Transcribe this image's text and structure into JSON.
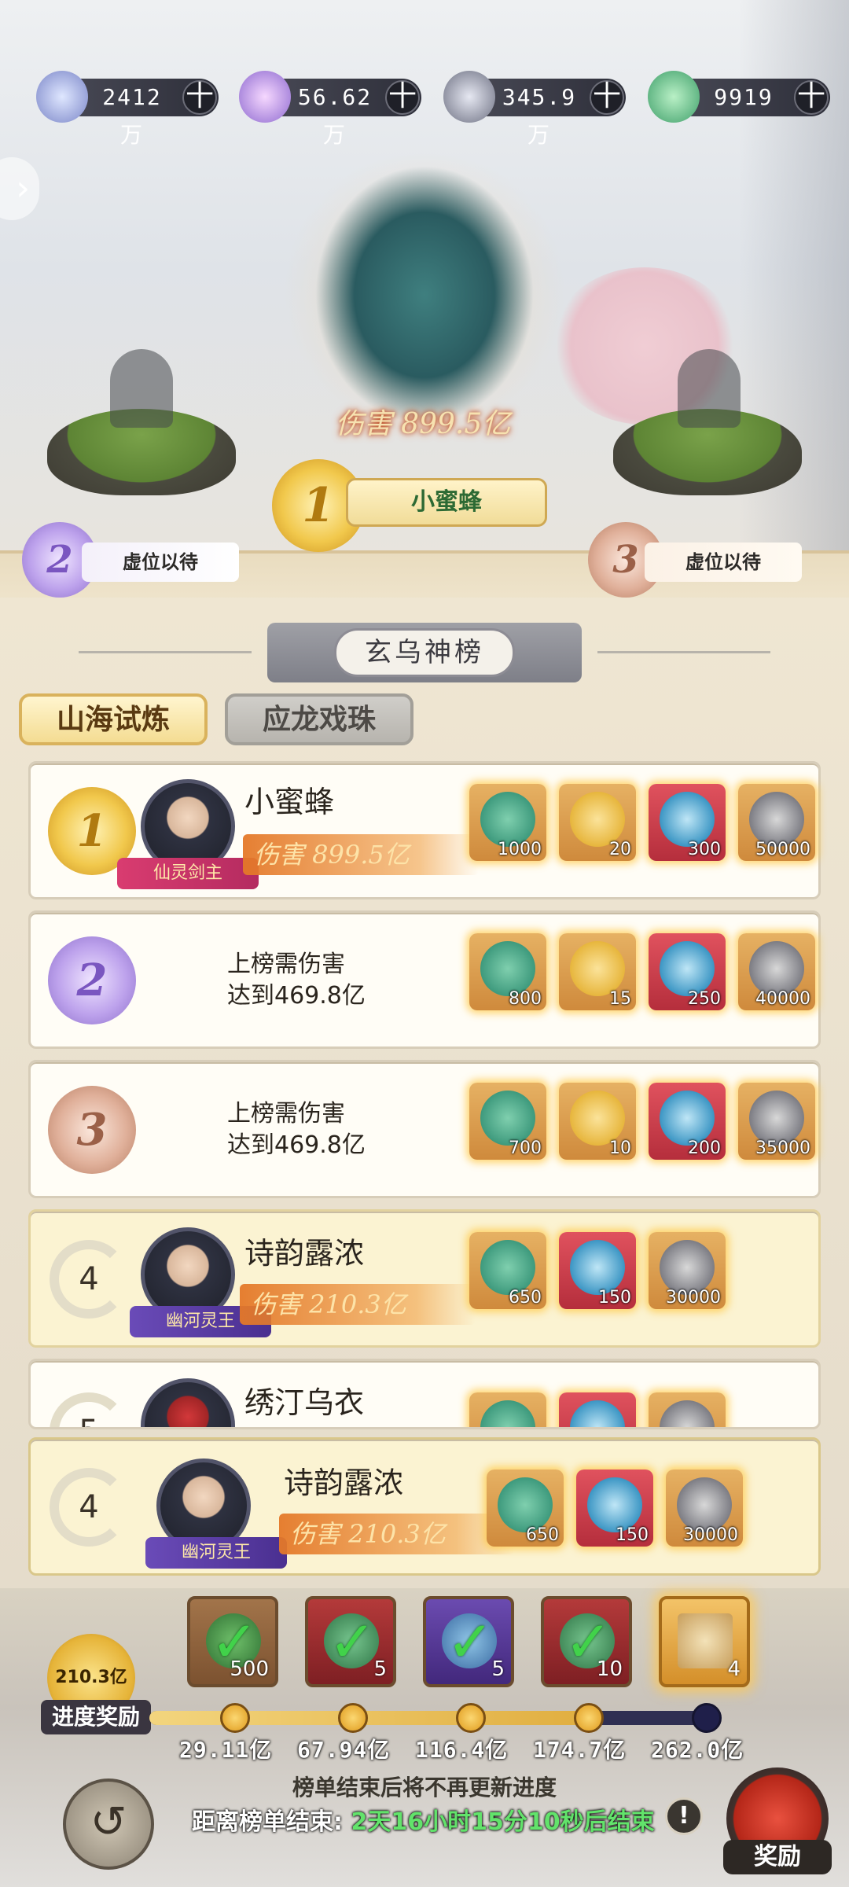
{
  "resources": [
    {
      "icon": "spirit-orb-icon",
      "value": "2412万"
    },
    {
      "icon": "crystal-icon",
      "value": "56.62万"
    },
    {
      "icon": "ore-icon",
      "value": "345.9万"
    },
    {
      "icon": "jade-pod-icon",
      "value": "9919"
    }
  ],
  "resource_plus": "十",
  "podium": {
    "first": {
      "rank": "1",
      "name": "小蜜蜂",
      "damage": "伤害 899.5亿"
    },
    "second": {
      "rank": "2",
      "label": "虚位以待"
    },
    "third": {
      "rank": "3",
      "label": "虚位以待"
    }
  },
  "board_title": "玄乌神榜",
  "tabs": [
    "山海试炼",
    "应龙戏珠"
  ],
  "rows": [
    {
      "rank": "1",
      "name": "小蜜蜂",
      "title": "仙灵剑主",
      "damage": "伤害 899.5亿",
      "rewards": [
        {
          "icon": "jade-pod-icon",
          "count": "1000"
        },
        {
          "icon": "golden-cloud-icon",
          "count": "20"
        },
        {
          "icon": "yin-yang-icon",
          "count": "300"
        },
        {
          "icon": "beast-mask-icon",
          "count": "50000"
        }
      ]
    },
    {
      "rank": "2",
      "req_line1": "上榜需伤害",
      "req_line2": "达到469.8亿",
      "rewards": [
        {
          "icon": "jade-pod-icon",
          "count": "800"
        },
        {
          "icon": "golden-cloud-icon",
          "count": "15"
        },
        {
          "icon": "yin-yang-icon",
          "count": "250"
        },
        {
          "icon": "beast-mask-icon",
          "count": "40000"
        }
      ]
    },
    {
      "rank": "3",
      "req_line1": "上榜需伤害",
      "req_line2": "达到469.8亿",
      "rewards": [
        {
          "icon": "jade-pod-icon",
          "count": "700"
        },
        {
          "icon": "golden-cloud-icon",
          "count": "10"
        },
        {
          "icon": "yin-yang-icon",
          "count": "200"
        },
        {
          "icon": "beast-mask-icon",
          "count": "35000"
        }
      ]
    },
    {
      "rank": "4",
      "name": "诗韵露浓",
      "title": "幽河灵王",
      "damage": "伤害 210.3亿",
      "rewards": [
        {
          "icon": "jade-pod-icon",
          "count": "650"
        },
        {
          "icon": "yin-yang-icon",
          "count": "150"
        },
        {
          "icon": "beast-mask-icon",
          "count": "30000"
        }
      ]
    },
    {
      "rank": "5",
      "name": "绣汀乌衣"
    }
  ],
  "my_row": {
    "rank": "4",
    "name": "诗韵露浓",
    "title": "幽河灵王",
    "damage": "伤害 210.3亿",
    "rewards": [
      {
        "icon": "jade-pod-icon",
        "count": "650"
      },
      {
        "icon": "yin-yang-icon",
        "count": "150"
      },
      {
        "icon": "beast-mask-icon",
        "count": "30000"
      }
    ]
  },
  "progress": {
    "label": "进度奖励",
    "current": "210.3亿",
    "current_fraction": 0.8,
    "chests": [
      {
        "icon": "green-seed-icon",
        "count": "500",
        "claimed": true
      },
      {
        "icon": "green-pouch-icon",
        "count": "5",
        "claimed": true
      },
      {
        "icon": "blue-scroll-icon",
        "count": "5",
        "claimed": true
      },
      {
        "icon": "green-pouch-icon",
        "count": "10",
        "claimed": true
      },
      {
        "icon": "paper-scroll-icon",
        "count": "4",
        "claimed": false
      }
    ],
    "ticks": [
      "29.11亿",
      "67.94亿",
      "116.4亿",
      "174.7亿",
      "262.0亿"
    ]
  },
  "footer": {
    "note": "榜单结束后将不再更新进度",
    "timer_prefix": "距离榜单结束:",
    "timer_value": "2天16小时15分10秒后结束",
    "info": "!",
    "reward_button": "奖励",
    "back": "↺"
  }
}
